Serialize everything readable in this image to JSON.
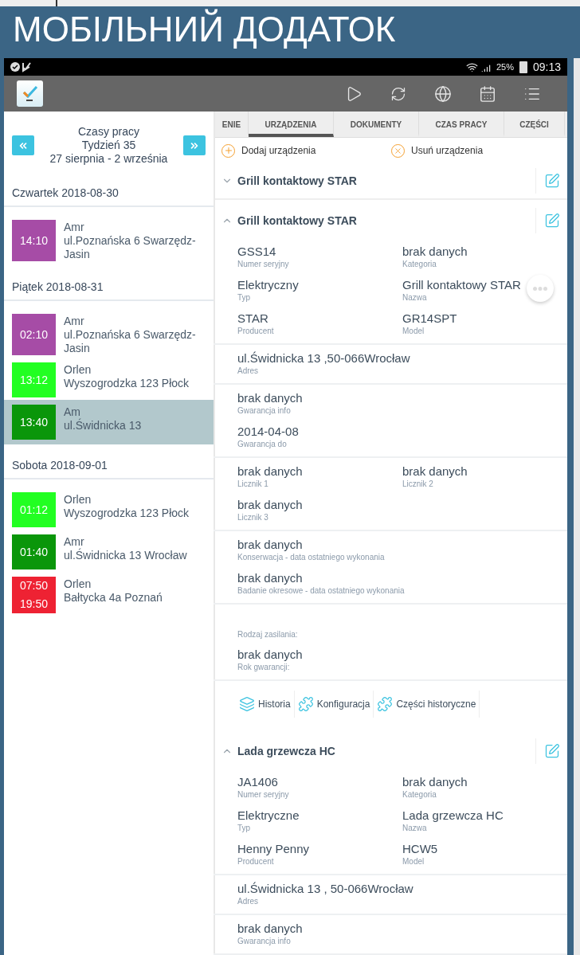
{
  "slide_title": "МОБІЛЬНИЙ ДОДАТОК",
  "status_bar": {
    "battery": "25%",
    "time": "09:13"
  },
  "sidebar": {
    "title": "Czasy pracy",
    "week": "Tydzień 35",
    "range": "27 sierpnia - 2 września",
    "days": [
      {
        "label": "Czwartek 2018-08-30",
        "entries": [
          {
            "times": [
              "14:10"
            ],
            "name": "Amr",
            "address": "ul.Poznańska 6 Swarzędz-Jasin",
            "color": "#a64ca6",
            "selected": false
          }
        ]
      },
      {
        "label": "Piątek 2018-08-31",
        "entries": [
          {
            "times": [
              "02:10"
            ],
            "name": "Amr",
            "address": "ul.Poznańska 6 Swarzędz-Jasin",
            "color": "#a64ca6",
            "selected": false
          },
          {
            "times": [
              "13:12"
            ],
            "name": "Orlen",
            "address": "Wyszogrodzka 123 Płock",
            "color": "#22ff22",
            "selected": false
          },
          {
            "times": [
              "13:40"
            ],
            "name": "Am",
            "address": "ul.Świdnicka 13",
            "color": "#0a960a",
            "selected": true
          }
        ]
      },
      {
        "label": "Sobota 2018-09-01",
        "entries": [
          {
            "times": [
              "01:12"
            ],
            "name": "Orlen",
            "address": "Wyszogrodzka 123 Płock",
            "color": "#22ff22",
            "selected": false
          },
          {
            "times": [
              "01:40"
            ],
            "name": "Amr",
            "address": "ul.Świdnicka 13 Wrocław",
            "color": "#0a960a",
            "selected": false
          },
          {
            "times": [
              "07:50",
              "19:50"
            ],
            "name": "Orlen",
            "address": "Bałtycka 4a Poznań",
            "color": "#ee2233",
            "selected": false
          }
        ]
      }
    ]
  },
  "tabs": [
    {
      "label": "ENIE",
      "selected": false
    },
    {
      "label": "URZĄDZENIA",
      "selected": true
    },
    {
      "label": "DOKUMENTY",
      "selected": false
    },
    {
      "label": "CZAS PRACY",
      "selected": false
    },
    {
      "label": "CZĘŚCI",
      "selected": false
    }
  ],
  "actions": [
    {
      "kind": "add",
      "label": "Dodaj urządzenia"
    },
    {
      "kind": "remove",
      "label": "Usuń urządzenia"
    }
  ],
  "devices": [
    {
      "title": "Grill kontaktowy STAR",
      "expanded": false
    },
    {
      "title": "Grill kontaktowy STAR",
      "expanded": true,
      "sections": [
        {
          "rows": [
            {
              "kind": "fields",
              "fields": [
                {
                  "value": "GSS14",
                  "label": "Numer seryjny"
                },
                {
                  "value": "brak danych",
                  "label": "Kategoria"
                }
              ]
            },
            {
              "kind": "fields",
              "fields": [
                {
                  "value": "Elektryczny",
                  "label": "Typ"
                },
                {
                  "value": "Grill kontaktowy STAR",
                  "label": "Nazwa"
                }
              ]
            },
            {
              "kind": "fields",
              "fields": [
                {
                  "value": "STAR",
                  "label": "Producent"
                },
                {
                  "value": "GR14SPT",
                  "label": "Model"
                }
              ]
            }
          ]
        },
        {
          "rows": [
            {
              "kind": "fields",
              "fields": [
                {
                  "value": "ul.Świdnicka 13 ,50-066Wrocław",
                  "label": "Adres"
                }
              ]
            }
          ]
        },
        {
          "rows": [
            {
              "kind": "fields",
              "fields": [
                {
                  "value": "brak danych",
                  "label": "Gwarancja info"
                }
              ]
            },
            {
              "kind": "fields",
              "fields": [
                {
                  "value": "2014-04-08",
                  "label": "Gwarancja do"
                }
              ]
            }
          ]
        },
        {
          "rows": [
            {
              "kind": "fields",
              "fields": [
                {
                  "value": "brak danych",
                  "label": "Licznik 1"
                },
                {
                  "value": "brak danych",
                  "label": "Licznik 2"
                }
              ]
            },
            {
              "kind": "fields",
              "fields": [
                {
                  "value": "brak danych",
                  "label": "Licznik 3"
                }
              ]
            }
          ]
        },
        {
          "rows": [
            {
              "kind": "fields",
              "fields": [
                {
                  "value": "brak danych",
                  "label": "Konserwacja - data ostatniego wykonania"
                }
              ]
            },
            {
              "kind": "fields",
              "fields": [
                {
                  "value": "brak danych",
                  "label": "Badanie okresowe - data ostatniego wykonania"
                }
              ]
            }
          ]
        },
        {
          "rows": [
            {
              "kind": "caption",
              "text": "Rodzaj zasilania:"
            },
            {
              "kind": "fields",
              "fields": [
                {
                  "value": "brak danych",
                  "label": "Rok gwarancji:"
                }
              ]
            }
          ]
        }
      ],
      "links": [
        {
          "kind": "layers",
          "label": "Historia"
        },
        {
          "kind": "puzzle",
          "label": "Konfiguracja"
        },
        {
          "kind": "puzzle",
          "label": "Części historyczne"
        }
      ]
    },
    {
      "title": "Lada grzewcza HC",
      "expanded": true,
      "sections": [
        {
          "rows": [
            {
              "kind": "fields",
              "fields": [
                {
                  "value": "JA1406",
                  "label": "Numer seryjny"
                },
                {
                  "value": "brak danych",
                  "label": "Kategoria"
                }
              ]
            },
            {
              "kind": "fields",
              "fields": [
                {
                  "value": "Elektryczne",
                  "label": "Typ"
                },
                {
                  "value": "Lada grzewcza HC",
                  "label": "Nazwa"
                }
              ]
            },
            {
              "kind": "fields",
              "fields": [
                {
                  "value": "Henny Penny",
                  "label": "Producent"
                },
                {
                  "value": "HCW5",
                  "label": "Model"
                }
              ]
            }
          ]
        },
        {
          "rows": [
            {
              "kind": "fields",
              "fields": [
                {
                  "value": "ul.Świdnicka 13 , 50-066Wrocław",
                  "label": "Adres"
                }
              ]
            }
          ]
        },
        {
          "rows": [
            {
              "kind": "fields",
              "fields": [
                {
                  "value": "brak danych",
                  "label": "Gwarancja info"
                }
              ]
            }
          ]
        }
      ]
    }
  ]
}
